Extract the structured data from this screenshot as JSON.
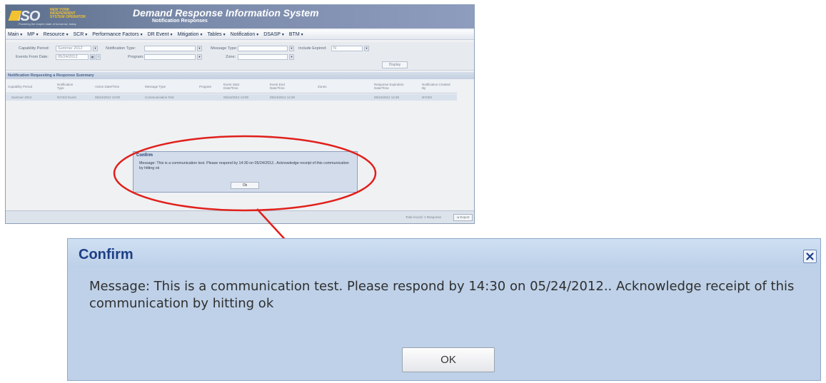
{
  "app": {
    "logo_mark": "ISO",
    "logo_text": "NEW YORK INDEPENDENT SYSTEM OPERATOR",
    "logo_tag": "Powering the empire state of tomorrow, today.",
    "title": "Demand Response Information System",
    "subtitle": "Notification Responses"
  },
  "menu": [
    {
      "label": "Main"
    },
    {
      "label": "MP"
    },
    {
      "label": "Resource"
    },
    {
      "label": "SCR"
    },
    {
      "label": "Performance Factors"
    },
    {
      "label": "DR Event"
    },
    {
      "label": "Mitigation"
    },
    {
      "label": "Tables"
    },
    {
      "label": "Notification"
    },
    {
      "label": "DSASP"
    },
    {
      "label": "BTM"
    }
  ],
  "filters": {
    "capability_period_label": "Capability Period:",
    "capability_period_value": "Summer 2012",
    "notification_type_label": "Notification Type:",
    "message_type_label": "Message Type:",
    "include_expired_label": "Include Expired:",
    "include_expired_value": "N",
    "events_from_label": "Events From Date:",
    "events_from_value": "05/24/2012",
    "program_label": "Program:",
    "zone_label": "Zone:",
    "display_label": "Display"
  },
  "grid": {
    "title": "Notification Requesting a Response Summary",
    "columns": [
      "Capability Period",
      "Notification Type",
      "Active Date/Time",
      "Message Type",
      "Program",
      "Event Start Date/Time",
      "Event End Date/Time",
      "Zones",
      "Response Expiration Date/Time",
      "Notification Created By"
    ],
    "row": [
      "Summer 2012",
      "NYISO Event",
      "05/24/2012 13:00",
      "Communication Test",
      "",
      "05/24/2012 13:00",
      "05/24/2012 14:30",
      "",
      "05/24/2012 14:30",
      "NYISO"
    ]
  },
  "status": {
    "total": "Total record: 1  Response",
    "export": "Export"
  },
  "dialog": {
    "title": "Confirm",
    "message": "Message: This is a communication test. Please respond by 14:30 on 05/24/2012.. Acknowledge receipt of this communication by hitting ok",
    "ok_small": "Ok",
    "ok": "OK"
  },
  "colors": {
    "annotation": "#e0201b",
    "dialog_title": "#1d3f86",
    "header": "#6b7d9c"
  }
}
